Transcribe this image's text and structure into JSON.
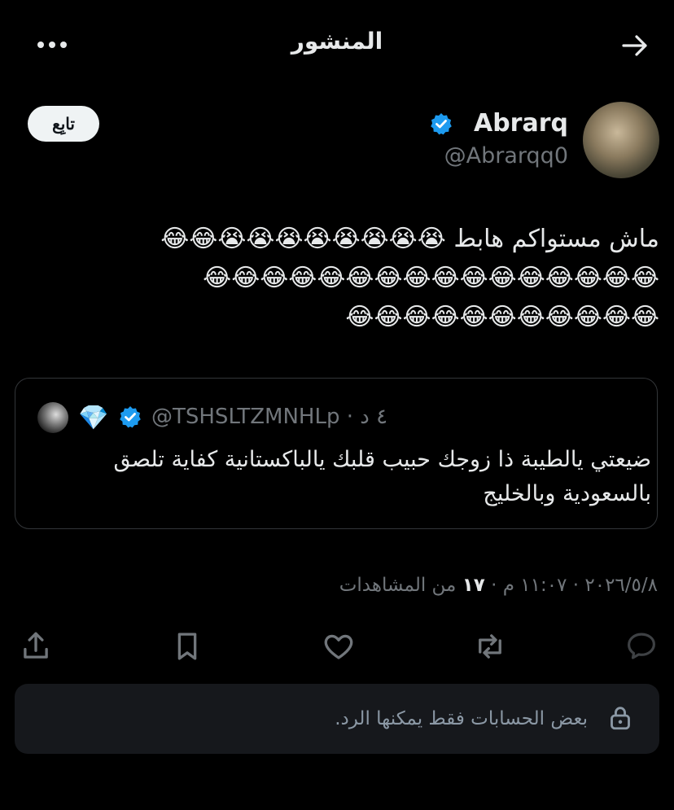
{
  "header": {
    "title": "المنشور",
    "back_icon": "arrow-right-icon",
    "more_icon": "more-dots-icon"
  },
  "author": {
    "name": "Abrarq",
    "handle": "@Abrarqq0",
    "follow_label": "تابِع",
    "verified": true
  },
  "tweet": {
    "text": "ماش مستواكم هابط",
    "emoji_line1": "😭😭😭😭😭😭😭😭😂😂",
    "emoji_line2": "😂😂😂😂😂😂😂😂😂😂😂😂😂😂😂😂",
    "emoji_line3": "😂😂😂😂😂😂😂😂😂😂😂"
  },
  "quote": {
    "handle": "@TSHSLTZMNHLp",
    "time": "٤ د",
    "badge": "💎",
    "text": "ضيعتي يالطيبة ذا زوجك حبيب قلبك يالباكستانية كفاية تلصق بالسعودية وبالخليج"
  },
  "meta": {
    "date": "٢٠٢٦/٥/٨",
    "time": "١١:٠٧ م",
    "views": "١٧",
    "views_label": "من المشاهدات",
    "separator": " · "
  },
  "actions": [
    "reply-icon",
    "retweet-icon",
    "like-icon",
    "bookmark-icon",
    "share-icon"
  ],
  "restriction": {
    "text": "بعض الحسابات فقط يمكنها الرد.",
    "icon": "lock-icon"
  },
  "colors": {
    "background": "#000000",
    "text": "#e7e9ea",
    "muted": "#71767b",
    "verified": "#1d9bf0",
    "card": "#16181c"
  }
}
